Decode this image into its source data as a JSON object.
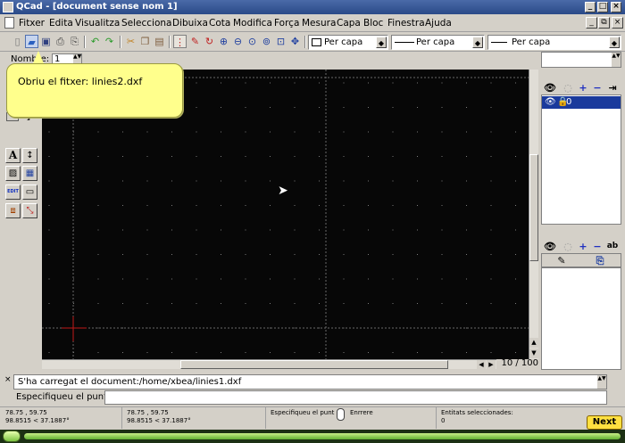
{
  "window": {
    "title": "QCad - [document sense nom 1]"
  },
  "menubar": {
    "items": [
      "Fitxer",
      "Edita",
      "Visualitza",
      "Selecciona",
      "Dibuixa",
      "Cota",
      "Modifica",
      "Força",
      "Mesura",
      "Capa",
      "Bloc",
      "Finestra",
      "Ajuda"
    ]
  },
  "toolbar": {
    "combos": [
      {
        "label": "Per capa",
        "kind": "color"
      },
      {
        "label": "Per capa",
        "kind": "width"
      },
      {
        "label": "Per capa",
        "kind": "linetype"
      }
    ]
  },
  "nombre": {
    "label": "Nombre:",
    "value": "1"
  },
  "tooltip": {
    "text": "Obriu el fitxer: linies2.dxf"
  },
  "canvas": {
    "page_indicator": "10 / 100"
  },
  "layers": {
    "items": [
      {
        "name": "0"
      }
    ]
  },
  "command": {
    "history": "S'ha carregat el document:/home/xbea/linies1.dxf",
    "prompt": "Especifiqueu el punt"
  },
  "status": {
    "abs_coord": "78.75 , 59.75",
    "abs_polar": "98.8515 < 37.1887°",
    "rel_coord": "78.75 , 59.75",
    "rel_polar": "98.8515 < 37.1887°",
    "mouse_left": "Especifiqueu el punt",
    "mouse_right": "Enrrere",
    "selected_label": "Entitats seleccionades:",
    "selected_count": "0"
  },
  "tutorial": {
    "next_label": "Next",
    "progress_fraction": 1.0
  },
  "colors": {
    "canvas_bg": "#070707",
    "tooltip_bg": "#ffff8c",
    "title_bg": "#2a4a88",
    "selection": "#1a3a9c"
  }
}
